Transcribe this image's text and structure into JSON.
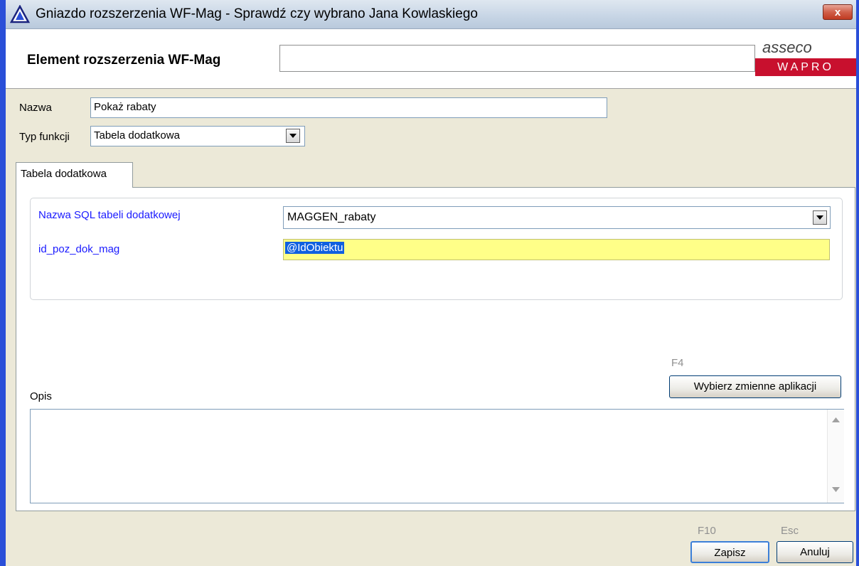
{
  "window": {
    "title": "Gniazdo rozszerzenia WF-Mag - Sprawdź czy wybrano Jana Kowlaskiego",
    "close_label": "x"
  },
  "header": {
    "element_label": "Element rozszerzenia WF-Mag",
    "element_value": "",
    "logo_brand": "asseco",
    "logo_product": "WAPRO"
  },
  "form": {
    "nazwa_label": "Nazwa",
    "nazwa_value": "Pokaż rabaty",
    "typ_label": "Typ funkcji",
    "typ_value": "Tabela dodatkowa"
  },
  "tab": {
    "label": "Tabela dodatkowa"
  },
  "panel": {
    "sql_label": "Nazwa SQL tabeli dodatkowej",
    "sql_value": "MAGGEN_rabaty",
    "id_label": "id_poz_dok_mag",
    "id_value": "@IdObiektu"
  },
  "variables": {
    "hotkey": "F4",
    "button_label": "Wybierz zmienne aplikacji"
  },
  "opis": {
    "label": "Opis",
    "value": ""
  },
  "footer": {
    "save_hotkey": "F10",
    "save_label": "Zapisz",
    "cancel_hotkey": "Esc",
    "cancel_label": "Anuluj"
  },
  "colors": {
    "frame": "#2a4fd8",
    "label_blue": "#1a1aff",
    "highlight_field": "#ffff88",
    "logo_red": "#c8102e"
  },
  "icons": {
    "title": "warning-triangle-icon",
    "close": "close-icon",
    "dropdown": "chevron-down-icon",
    "scroll_up": "scroll-up-arrow-icon",
    "scroll_down": "scroll-down-arrow-icon"
  }
}
